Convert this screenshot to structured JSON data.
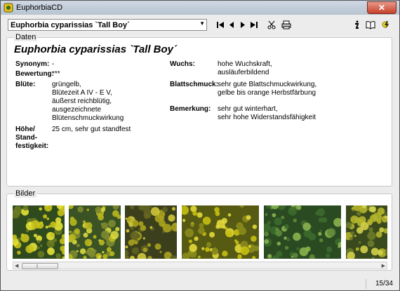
{
  "window": {
    "title": "EuphorbiaCD",
    "close_glyph": "✕"
  },
  "toolbar": {
    "selected_plant": "Euphorbia cyparissias `Tall Boy´",
    "icons": [
      "first-record-icon",
      "previous-record-icon",
      "next-record-icon",
      "last-record-icon",
      "scissors-icon",
      "printer-icon",
      "info-icon",
      "book-icon",
      "sun-lightning-icon"
    ]
  },
  "daten": {
    "legend": "Daten",
    "name": "Euphorbia cyparissias  `Tall Boy´",
    "left": [
      {
        "label": "Synonym:",
        "value": "-"
      },
      {
        "label": "Bewertung:",
        "value": "***"
      },
      {
        "label": "Blüte:",
        "value": "grüngelb,\nBlütezeit A IV - E V,\näußerst reichblütig,\nausgezeichnete\nBlütenschmuckwirkung"
      },
      {
        "label": "Höhe/\nStand-\nfestigkeit:",
        "value": "25 cm, sehr gut standfest"
      }
    ],
    "right": [
      {
        "label": "Wuchs:",
        "value": "hohe Wuchskraft,\nausläuferbildend"
      },
      {
        "label": "Blattschmuck:",
        "value": "sehr gute Blattschmuckwirkung,\ngelbe bis orange Herbstfärbung"
      },
      {
        "label": "Bemerkung:",
        "value": "sehr gut winterhart,\nsehr hohe Widerstandsfähigkeit"
      }
    ]
  },
  "bilder": {
    "legend": "Bilder",
    "thumbnails": [
      {
        "name": "photo-yellow-bracts-closeup",
        "palette": [
          "#2f4a1c",
          "#c8c21c",
          "#e6e23a",
          "#6a7a22"
        ]
      },
      {
        "name": "photo-yellow-bracts-cluster",
        "palette": [
          "#3a5224",
          "#b9b71e",
          "#d8d840",
          "#7d8a30"
        ]
      },
      {
        "name": "photo-flowering-shoots",
        "palette": [
          "#3c3f1c",
          "#a8a21e",
          "#d0c83a",
          "#5e6222"
        ]
      },
      {
        "name": "photo-yellow-carpet",
        "palette": [
          "#565a12",
          "#c7bf12",
          "#e2d83a",
          "#8a8a1c"
        ]
      },
      {
        "name": "photo-green-foliage",
        "palette": [
          "#2a4a22",
          "#5f8a3a",
          "#8ab24e",
          "#3c6a2c"
        ]
      },
      {
        "name": "photo-partial-closeup",
        "palette": [
          "#3a4a1c",
          "#b4b42c",
          "#d2d04a",
          "#6c7a2a"
        ]
      }
    ]
  },
  "status": {
    "record_counter": "15/34"
  }
}
